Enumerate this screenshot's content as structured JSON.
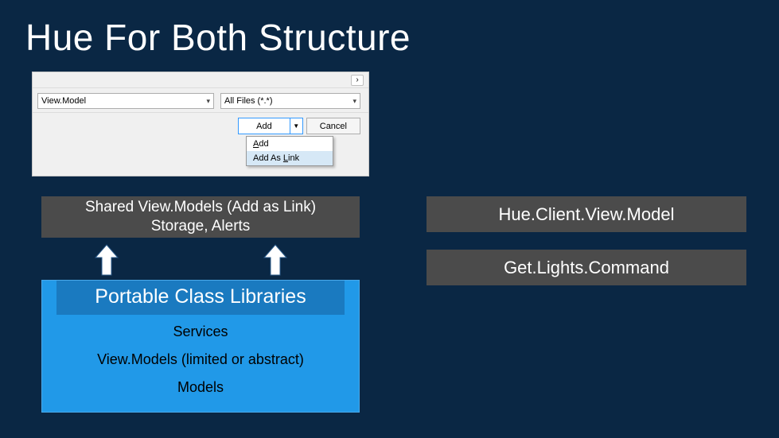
{
  "title": "Hue For Both Structure",
  "dialog": {
    "file_name": "View.Model",
    "filter": "All Files (*.*)",
    "add_label": "Add",
    "cancel_label": "Cancel",
    "menu": {
      "add": "Add",
      "add_as_link": "Add As Link"
    }
  },
  "shared": {
    "line1": "Shared View.Models (Add as Link)",
    "line2": "Storage, Alerts"
  },
  "pcl": {
    "header": "Portable Class Libraries",
    "rows": [
      "Services",
      "View.Models (limited or abstract)",
      "Models"
    ]
  },
  "right": {
    "box1": "Hue.Client.View.Model",
    "box2": "Get.Lights.Command"
  }
}
